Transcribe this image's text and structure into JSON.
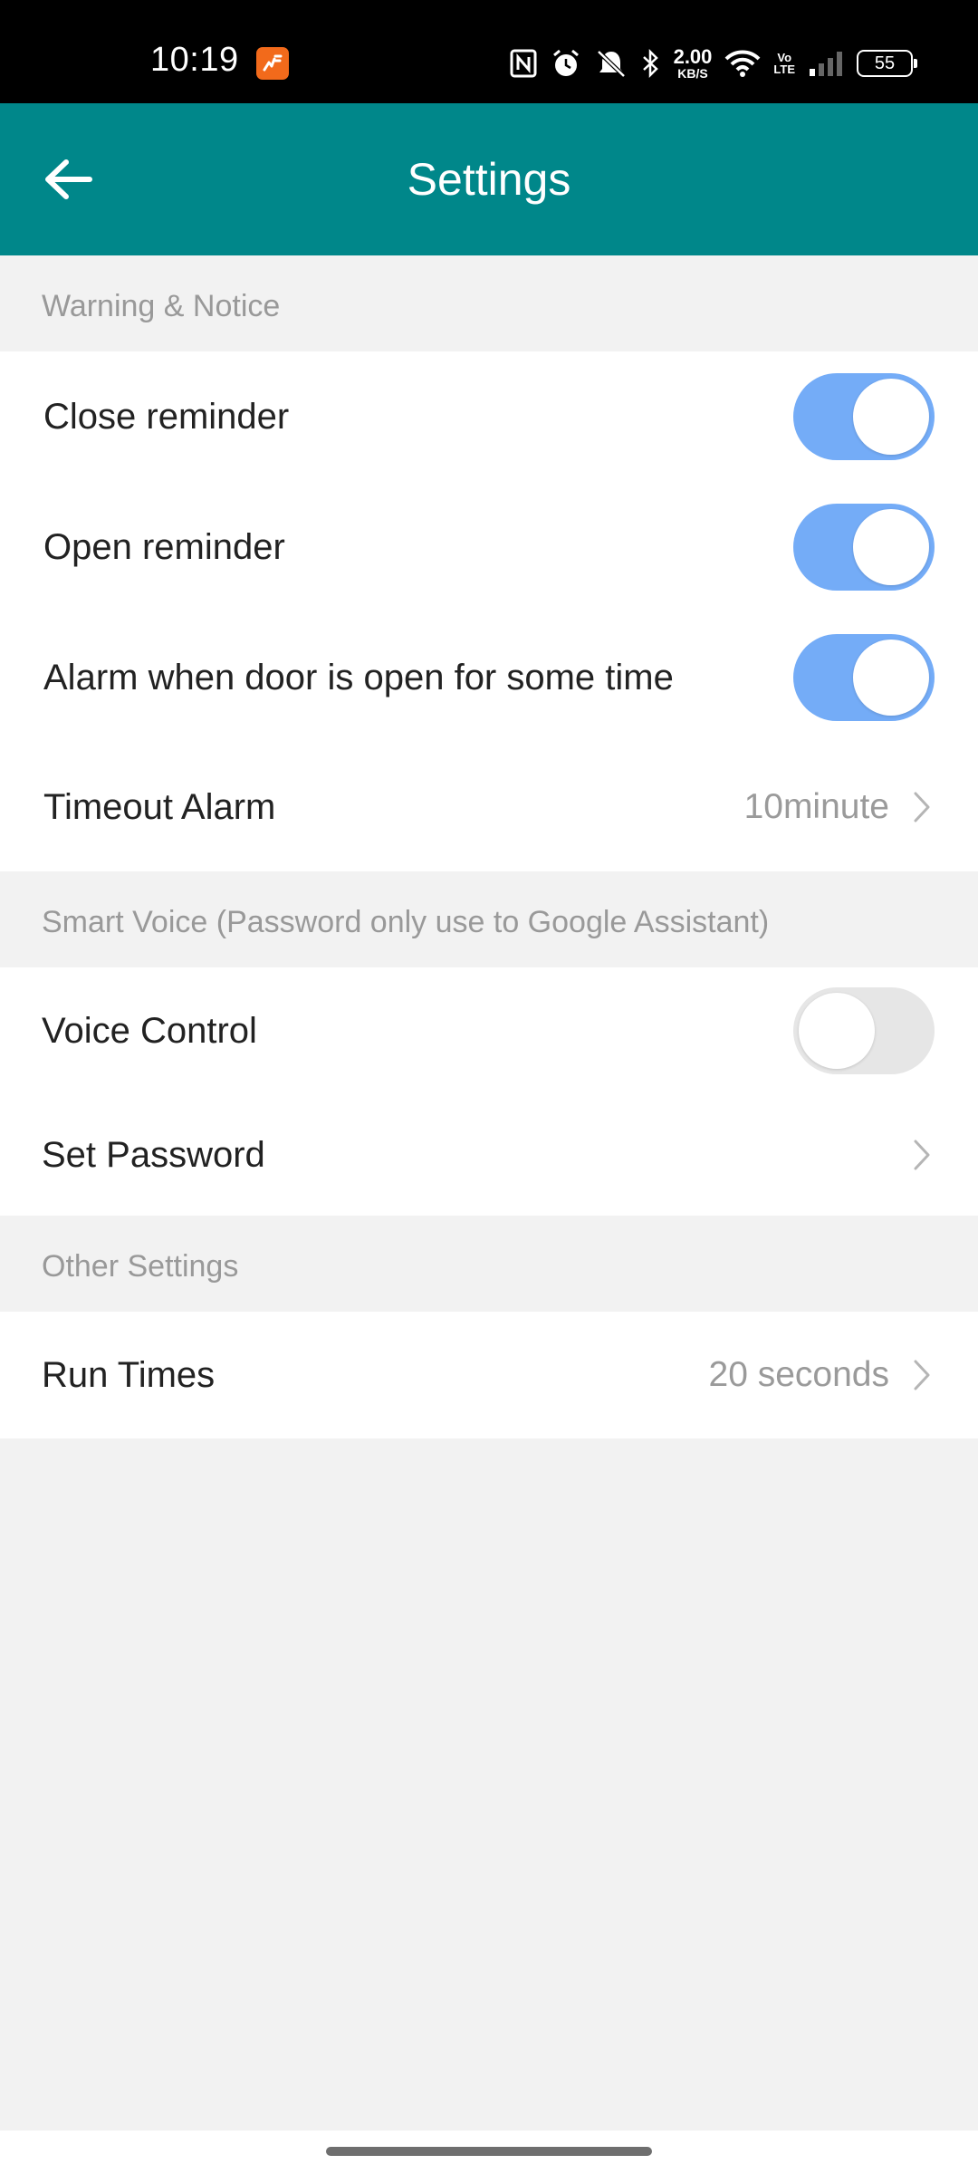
{
  "status_bar": {
    "time": "10:19",
    "net_speed_value": "2.00",
    "net_speed_unit": "KB/S",
    "volte_top": "Vo",
    "volte_bottom": "LTE",
    "battery": "55"
  },
  "app_bar": {
    "title": "Settings",
    "color": "#00878a"
  },
  "sections": {
    "warning": {
      "header": "Warning & Notice",
      "close_reminder": {
        "label": "Close reminder",
        "enabled": true
      },
      "open_reminder": {
        "label": "Open reminder",
        "enabled": true
      },
      "door_alarm": {
        "label": "Alarm when door is open for some time",
        "enabled": true
      },
      "timeout_alarm": {
        "label": "Timeout Alarm",
        "value": "10minute"
      }
    },
    "smart_voice": {
      "header": "Smart Voice (Password only use to Google Assistant)",
      "voice_control": {
        "label": "Voice Control",
        "enabled": false
      },
      "set_password": {
        "label": "Set Password"
      }
    },
    "other": {
      "header": "Other Settings",
      "run_times": {
        "label": "Run Times",
        "value": "20 seconds"
      }
    }
  },
  "colors": {
    "toggle_on": "#74acf7",
    "toggle_off": "#e6e6e6",
    "background": "#f2f2f2"
  }
}
